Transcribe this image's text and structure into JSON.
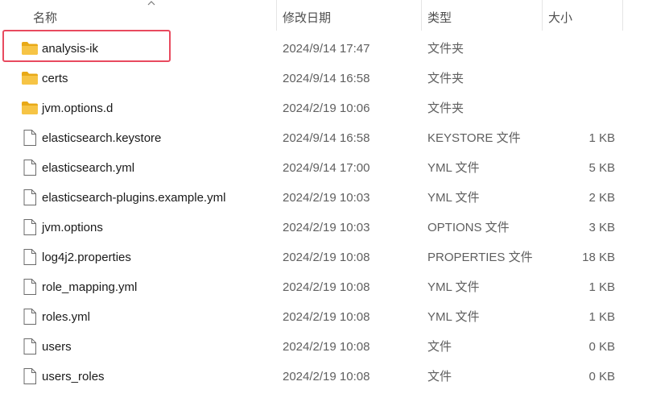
{
  "columns": {
    "name": "名称",
    "modified": "修改日期",
    "type": "类型",
    "size": "大小"
  },
  "files": [
    {
      "name": "analysis-ik",
      "modified": "2024/9/14 17:47",
      "type": "文件夹",
      "size": "",
      "kind": "folder",
      "highlighted": true
    },
    {
      "name": "certs",
      "modified": "2024/9/14 16:58",
      "type": "文件夹",
      "size": "",
      "kind": "folder"
    },
    {
      "name": "jvm.options.d",
      "modified": "2024/2/19 10:06",
      "type": "文件夹",
      "size": "",
      "kind": "folder"
    },
    {
      "name": "elasticsearch.keystore",
      "modified": "2024/9/14 16:58",
      "type": "KEYSTORE 文件",
      "size": "1 KB",
      "kind": "file"
    },
    {
      "name": "elasticsearch.yml",
      "modified": "2024/9/14 17:00",
      "type": "YML 文件",
      "size": "5 KB",
      "kind": "file"
    },
    {
      "name": "elasticsearch-plugins.example.yml",
      "modified": "2024/2/19 10:03",
      "type": "YML 文件",
      "size": "2 KB",
      "kind": "file"
    },
    {
      "name": "jvm.options",
      "modified": "2024/2/19 10:03",
      "type": "OPTIONS 文件",
      "size": "3 KB",
      "kind": "file"
    },
    {
      "name": "log4j2.properties",
      "modified": "2024/2/19 10:08",
      "type": "PROPERTIES 文件",
      "size": "18 KB",
      "kind": "file"
    },
    {
      "name": "role_mapping.yml",
      "modified": "2024/2/19 10:08",
      "type": "YML 文件",
      "size": "1 KB",
      "kind": "file"
    },
    {
      "name": "roles.yml",
      "modified": "2024/2/19 10:08",
      "type": "YML 文件",
      "size": "1 KB",
      "kind": "file"
    },
    {
      "name": "users",
      "modified": "2024/2/19 10:08",
      "type": "文件",
      "size": "0 KB",
      "kind": "file"
    },
    {
      "name": "users_roles",
      "modified": "2024/2/19 10:08",
      "type": "文件",
      "size": "0 KB",
      "kind": "file"
    }
  ],
  "colors": {
    "folder": "#f6c445",
    "folder_dark": "#e8a917",
    "highlight_border": "#e84a5f"
  },
  "icons": {
    "folder": "folder-icon",
    "file": "file-icon",
    "sort": "sort-ascending-icon"
  }
}
